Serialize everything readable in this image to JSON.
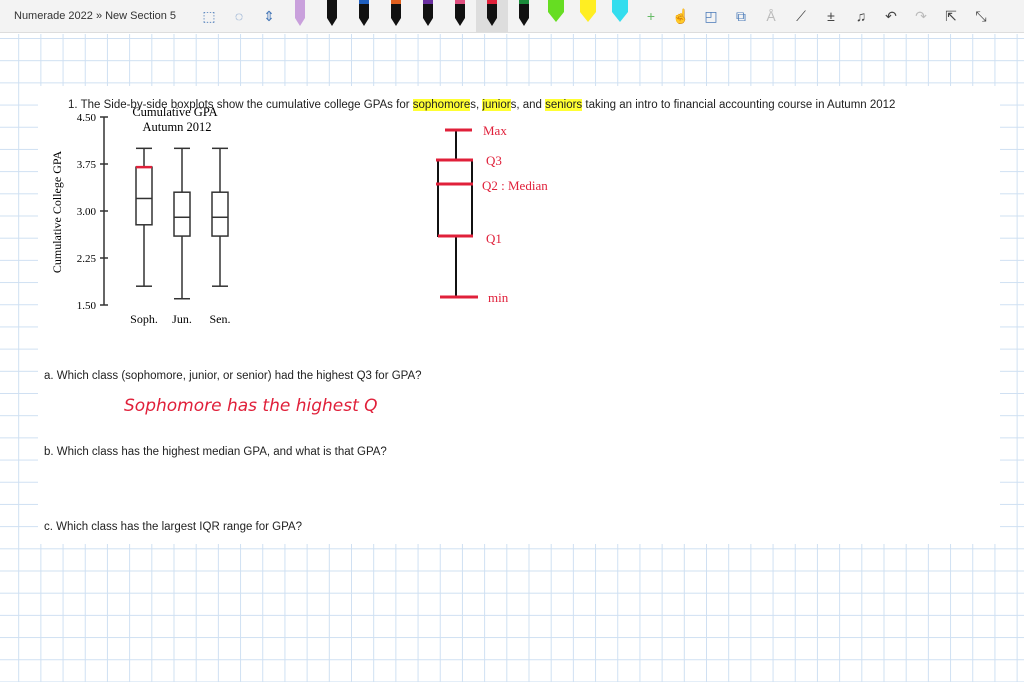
{
  "toolbar": {
    "breadcrumb": "Numerade 2022 » New Section 5",
    "pens": [
      {
        "color": "#c9a0dc"
      },
      {
        "color": "#111111"
      },
      {
        "color": "#1f5fbf"
      },
      {
        "color": "#e0601f"
      },
      {
        "color": "#6a2fa0"
      },
      {
        "color": "#e05080"
      },
      {
        "color": "#e0203a",
        "selected": true
      },
      {
        "color": "#1a8a3a"
      }
    ],
    "highlighters": [
      {
        "color": "#66dd22"
      },
      {
        "color": "#ffee22"
      },
      {
        "color": "#33ddee"
      }
    ],
    "icons": [
      "lasso-select-icon",
      "add-space-icon",
      "insert-space-icon",
      "plus-icon",
      "touch-draw-icon",
      "shapes-icon",
      "ink-to-shape-icon",
      "ink-to-text-icon",
      "ruler-icon",
      "math-icon",
      "replay-icon",
      "undo-icon",
      "redo-icon",
      "share-icon",
      "collapse-icon"
    ]
  },
  "question": {
    "intro": "1. The Side-by-side boxplots show the cumulative college GPAs for ",
    "w1": "sophomore",
    "s1": "s, ",
    "w2": "junior",
    "s2": "s, and ",
    "w3": "seniors",
    "rest": " taking an intro to financial accounting course in Autumn 2012",
    "a": "a. Which class (sophomore, junior, or senior) had the highest Q3 for GPA?",
    "b": "b. Which class has the highest median GPA, and what is that GPA?",
    "c": "c. Which class has the largest IQR range for GPA?"
  },
  "handwriting": {
    "answer_a": "Sophomore has the highest Q",
    "labels": {
      "max": "Max",
      "q3": "Q3",
      "q2": "Q2 : Median",
      "q1": "Q1",
      "min": "min"
    }
  },
  "chart_data": {
    "type": "boxplot",
    "title": "Cumulative GPA",
    "subtitle": "Autumn 2012",
    "ylabel": "Cumulative College GPA",
    "xlabel": "",
    "ylim": [
      1.5,
      4.5
    ],
    "yticks": [
      "4.50",
      "3.75",
      "3.00",
      "2.25",
      "1.50"
    ],
    "categories": [
      "Soph.",
      "Jun.",
      "Sen."
    ],
    "boxes": [
      {
        "min": 1.8,
        "q1": 2.78,
        "median": 3.2,
        "q3": 3.7,
        "max": 4.0
      },
      {
        "min": 1.6,
        "q1": 2.6,
        "median": 2.9,
        "q3": 3.3,
        "max": 4.0
      },
      {
        "min": 1.8,
        "q1": 2.6,
        "median": 2.9,
        "q3": 3.3,
        "max": 4.0
      }
    ],
    "annotation_color": "#e0203a"
  }
}
